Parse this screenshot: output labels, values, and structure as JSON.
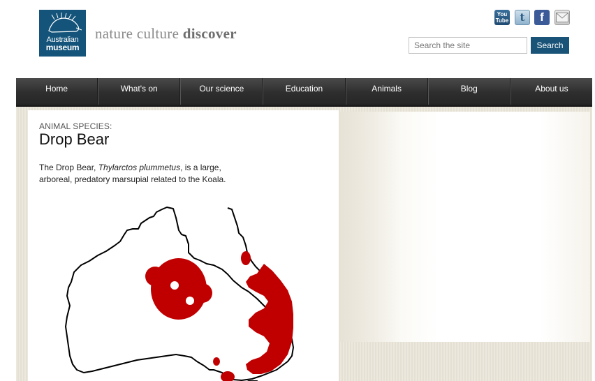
{
  "header": {
    "logo": {
      "line1": "Australian",
      "line2": "museum"
    },
    "tagline": {
      "part1": "nature culture",
      "part2": "discover"
    },
    "social": [
      {
        "name": "youtube",
        "label": "You Tube"
      },
      {
        "name": "twitter",
        "label": "t"
      },
      {
        "name": "facebook",
        "label": "f"
      },
      {
        "name": "email",
        "label": ""
      }
    ],
    "search": {
      "placeholder": "Search the site",
      "button_label": "Search"
    }
  },
  "nav": {
    "items": [
      {
        "label": "Home"
      },
      {
        "label": "What's on"
      },
      {
        "label": "Our science"
      },
      {
        "label": "Education"
      },
      {
        "label": "Animals"
      },
      {
        "label": "Blog"
      },
      {
        "label": "About us"
      }
    ]
  },
  "article": {
    "kicker": "ANIMAL SPECIES:",
    "title": "Drop Bear",
    "intro_before": "The Drop Bear, ",
    "intro_italic": "Thylarctos plummetus",
    "intro_after": ", is a large, arboreal, predatory marsupial related to the Koala."
  },
  "colors": {
    "brand_blue": "#14547a",
    "search_button": "#195478",
    "nav_bg": "#2e2e2e",
    "distribution_red": "#c00000"
  }
}
